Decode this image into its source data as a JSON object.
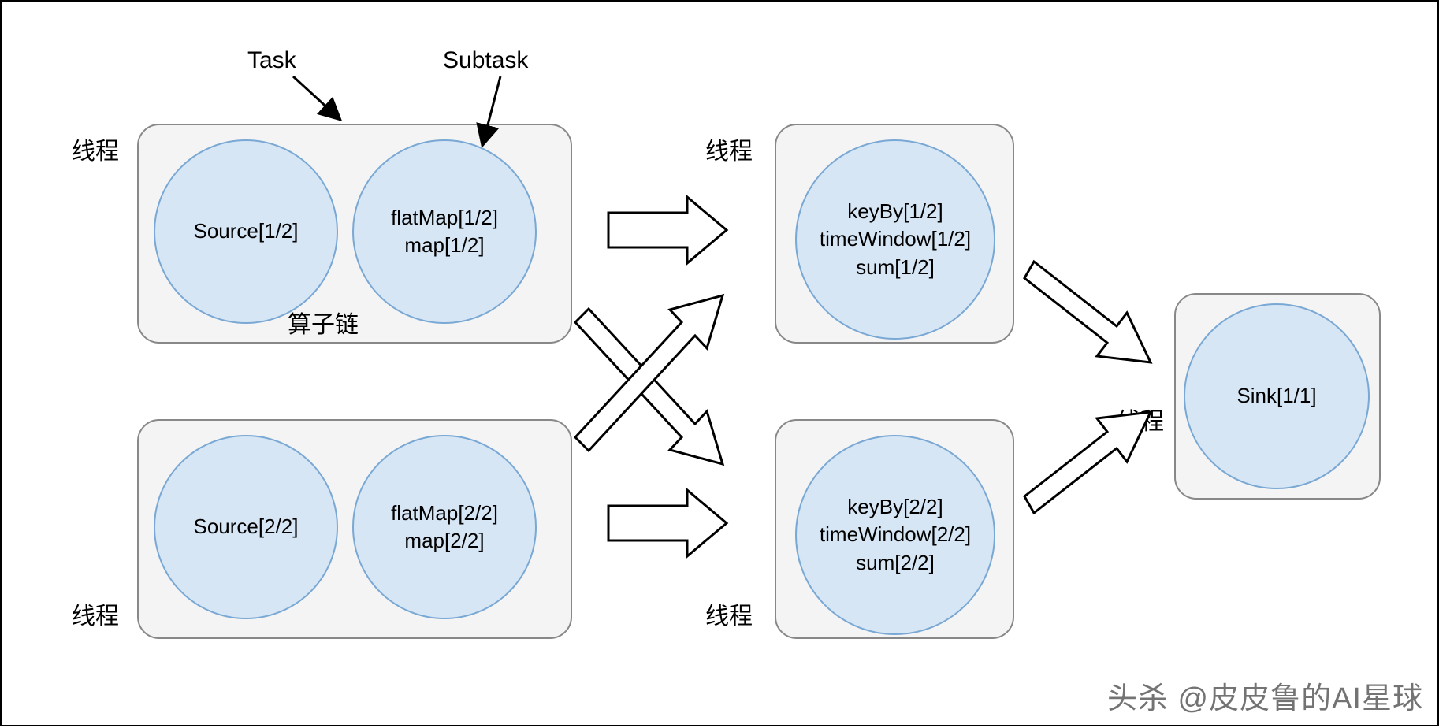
{
  "labels": {
    "task": "Task",
    "subtask": "Subtask",
    "thread": "线程",
    "operator_chain": "算子链"
  },
  "nodes": {
    "source1": "Source[1/2]",
    "source2": "Source[2/2]",
    "flatmap1_l1": "flatMap[1/2]",
    "flatmap1_l2": "map[1/2]",
    "flatmap2_l1": "flatMap[2/2]",
    "flatmap2_l2": "map[2/2]",
    "keyby1_l1": "keyBy[1/2]",
    "keyby1_l2": "timeWindow[1/2]",
    "keyby1_l3": "sum[1/2]",
    "keyby2_l1": "keyBy[2/2]",
    "keyby2_l2": "timeWindow[2/2]",
    "keyby2_l3": "sum[2/2]",
    "sink": "Sink[1/1]"
  },
  "watermark": "头杀 @皮皮鲁的AI星球"
}
